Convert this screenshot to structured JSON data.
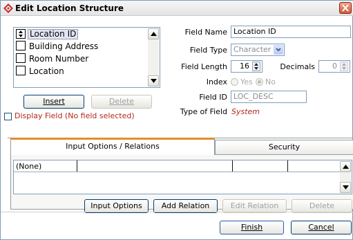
{
  "window": {
    "title": "Edit Location Structure"
  },
  "fields_list": {
    "items": [
      {
        "label": "Location ID",
        "selected": true
      },
      {
        "label": "Building Address",
        "selected": false
      },
      {
        "label": "Room Number",
        "selected": false
      },
      {
        "label": "Location",
        "selected": false
      }
    ]
  },
  "list_buttons": {
    "insert": "Insert",
    "delete": "Delete"
  },
  "display_field": {
    "label": "Display Field (No field selected)",
    "checked": false
  },
  "properties": {
    "field_name_label": "Field Name",
    "field_name_value": "Location ID",
    "field_type_label": "Field Type",
    "field_type_value": "Character",
    "field_length_label": "Field Length",
    "field_length_value": "16",
    "decimals_label": "Decimals",
    "decimals_value": "0",
    "index_label": "Index",
    "index_yes": "Yes",
    "index_no": "No",
    "field_id_label": "Field ID",
    "field_id_value": "LOC_DESC",
    "type_of_field_label": "Type of Field",
    "type_of_field_value": "System"
  },
  "tabs": [
    {
      "label": "Input Options / Relations",
      "active": true
    },
    {
      "label": "Security",
      "active": false
    }
  ],
  "relations_grid": {
    "first_cell": "(None)"
  },
  "panel_buttons": {
    "input_options": "Input Options",
    "add_relation": "Add Relation",
    "edit_relation": "Edit Relation",
    "delete": "Delete"
  },
  "footer_buttons": {
    "finish": "Finish",
    "cancel": "Cancel"
  },
  "colors": {
    "accent_tab": "#e68b2c",
    "system_text": "#b0291c",
    "display_field_text": "#b0291c"
  }
}
